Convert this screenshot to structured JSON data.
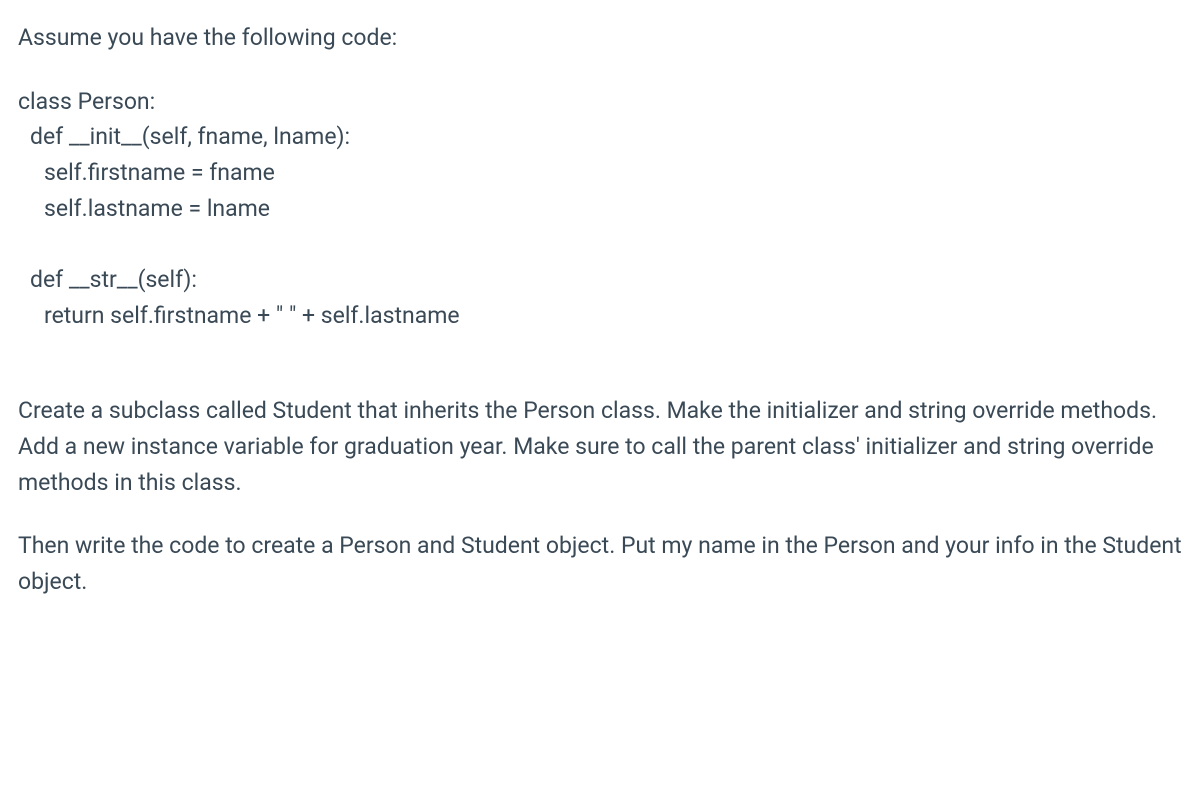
{
  "intro_text": "Assume you have the following code:",
  "code": {
    "line1": "class Person:",
    "line2": "def __init__(self, fname, lname):",
    "line3": "self.firstname = fname",
    "line4": "self.lastname = lname",
    "line5": "def __str__(self):",
    "line6": "return self.firstname + \" \" + self.lastname"
  },
  "instruction1": "Create a subclass called Student that inherits the Person class.  Make the initializer and string override methods.  Add a new instance variable for graduation year.  Make sure to call the parent class' initializer and string override methods in this class.",
  "instruction2": "Then write the code to create a Person and Student object.  Put my name in the Person and your info in the Student object."
}
